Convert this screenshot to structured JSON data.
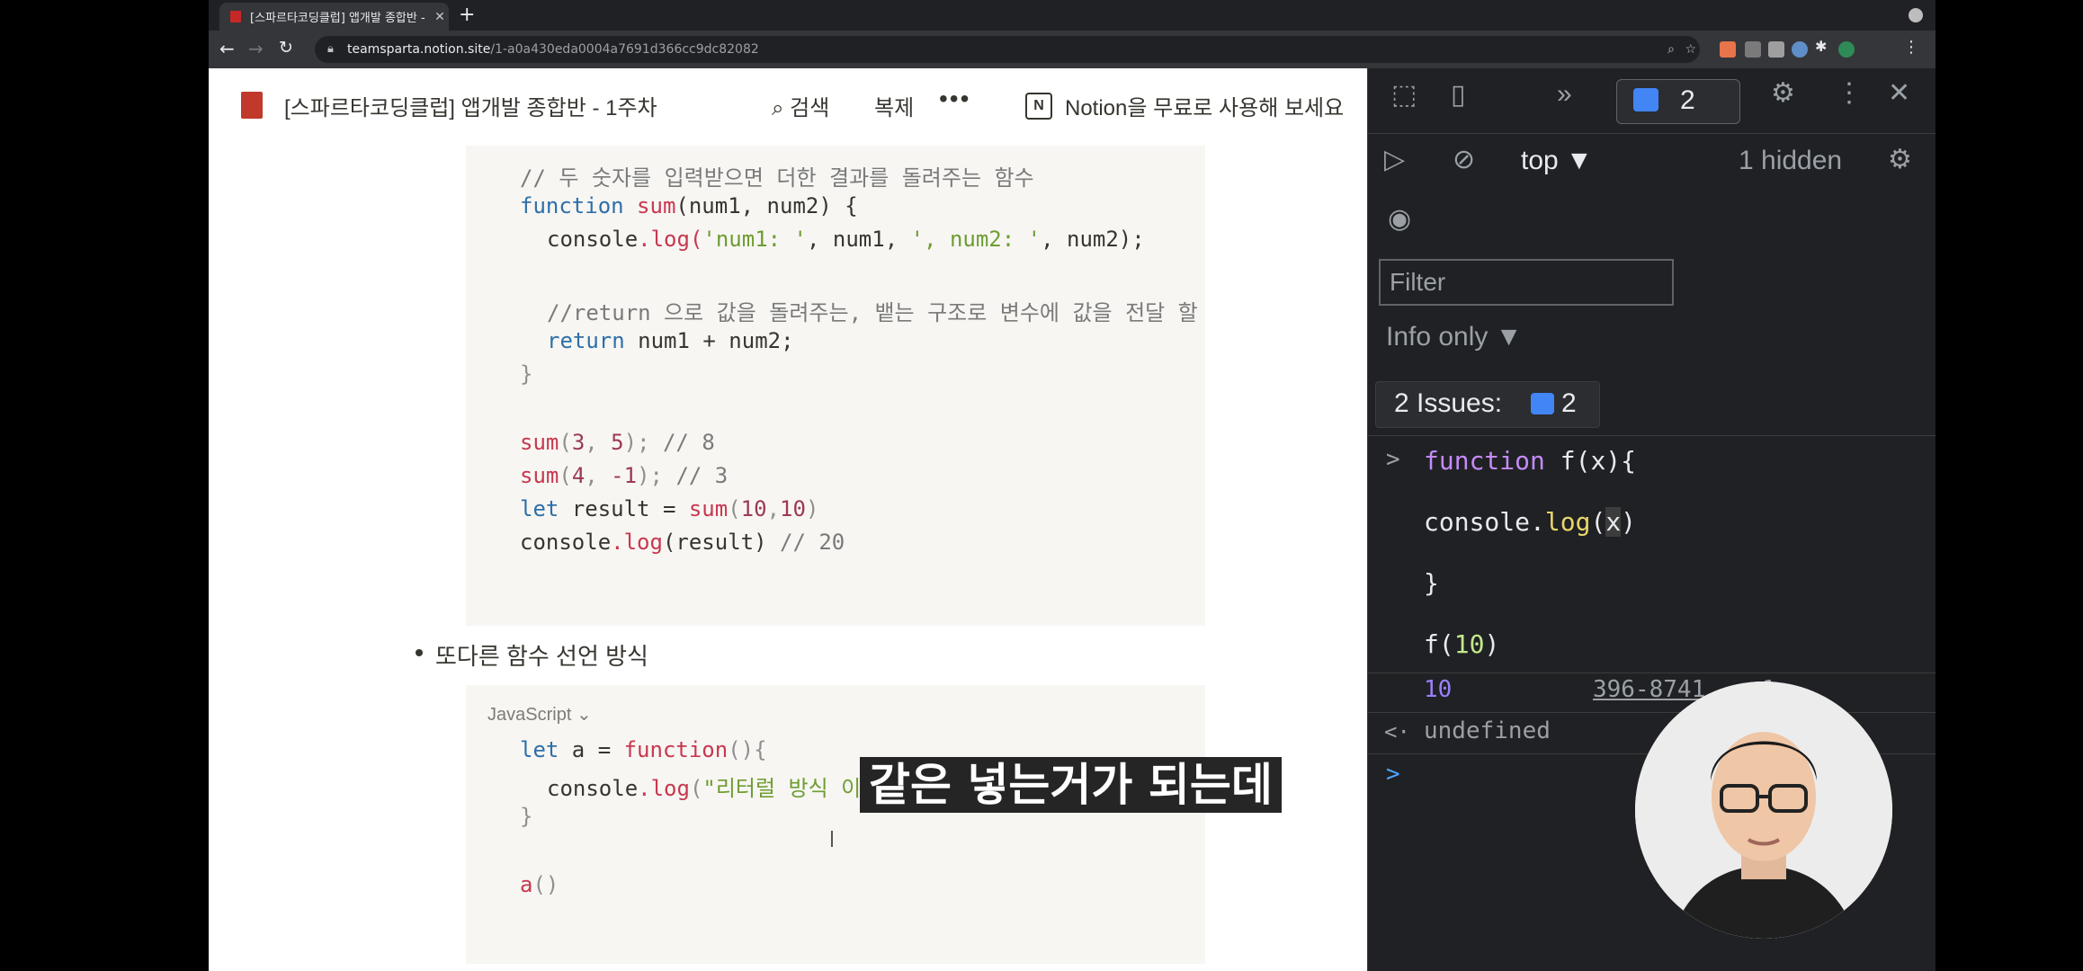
{
  "browser": {
    "tab_title": "[스파르타코딩클럽] 앱개발 종합반 -",
    "tab_close": "✕",
    "new_tab": "+",
    "url_host": "teamsparta.notion.site",
    "url_path": "/1-a0a430eda0004a7691d366cc9dc82082"
  },
  "notion": {
    "page_title": "[스파르타코딩클럽] 앱개발 종합반 - 1주차",
    "search_label": "검색",
    "duplicate_label": "복제",
    "more_label": "•••",
    "notion_logo": "N",
    "try_free_label": "Notion을 무료로 사용해 보세요",
    "code_block_1": {
      "line1": "// 두 숫자를 입력받으면 더한 결과를 돌려주는 함수",
      "line2_kw": "function",
      "line2_fn": "sum",
      "line2_rest": "(num1, num2) {",
      "line3_a": "console",
      "line3_b": ".log(",
      "line3_str1": "'num1: '",
      "line3_c": ", num1, ",
      "line3_str2": "', num2: '",
      "line3_d": ", num2);",
      "line5": "//return 으로 값을 돌려주는, 뱉는 구조로 변수에 값을 전달 할",
      "line6_kw": "return",
      "line6_rest": " num1 + num2;",
      "line7": "}",
      "line9_fn": "sum",
      "line9_a": "(",
      "line9_n1": "3",
      "line9_b": ", ",
      "line9_n2": "5",
      "line9_c": "); ",
      "line9_cm": "// 8",
      "line10_fn": "sum",
      "line10_a": "(",
      "line10_n1": "4",
      "line10_b": ", ",
      "line10_n2": "-1",
      "line10_c": "); ",
      "line10_cm": "// 3",
      "line11_kw": "let",
      "line11_a": " result = ",
      "line11_fn": "sum",
      "line11_b": "(",
      "line11_n1": "10",
      "line11_c": ",",
      "line11_n2": "10",
      "line11_d": ")",
      "line12_a": "console",
      "line12_fn": ".log",
      "line12_b": "(result) ",
      "line12_cm": "// 20"
    },
    "bullet_text": "또다른 함수 선언 방식",
    "code_block_2": {
      "language": "JavaScript",
      "language_chevron": "⌄",
      "line1_kw": "let",
      "line1_a": " a = ",
      "line1_fn": "function",
      "line1_b": "(){",
      "line2_a": "console",
      "line2_fn": ".log",
      "line2_b": "(",
      "line2_str": "\"리터럴 방식 이",
      "line3": "}",
      "line5_fn": "a",
      "line5_b": "()"
    }
  },
  "devtools": {
    "issues_count": "2",
    "context": "top ▼",
    "hidden": "1 hidden",
    "filter_placeholder": "Filter",
    "levels": "Info only ▼",
    "issues_label": "2 Issues:",
    "issues_btn_count": "2",
    "console": {
      "prompt": ">",
      "in1_kw": "function",
      "in1_a": " f(",
      "in1_x": "x",
      "in1_b": "){",
      "in2_a": "console",
      "in2_b": ".",
      "in2_log": "log",
      "in2_c": "(",
      "in2_x": "x",
      "in2_d": ")",
      "in3": "}",
      "in4_a": "f(",
      "in4_n": "10",
      "in4_b": ")",
      "out_value": "10",
      "out_source": "396-8741...:1",
      "return_arrow": "<·",
      "return_value": "undefined",
      "empty_prompt": ">"
    }
  },
  "subtitle": "같은 넣는거가 되는데"
}
